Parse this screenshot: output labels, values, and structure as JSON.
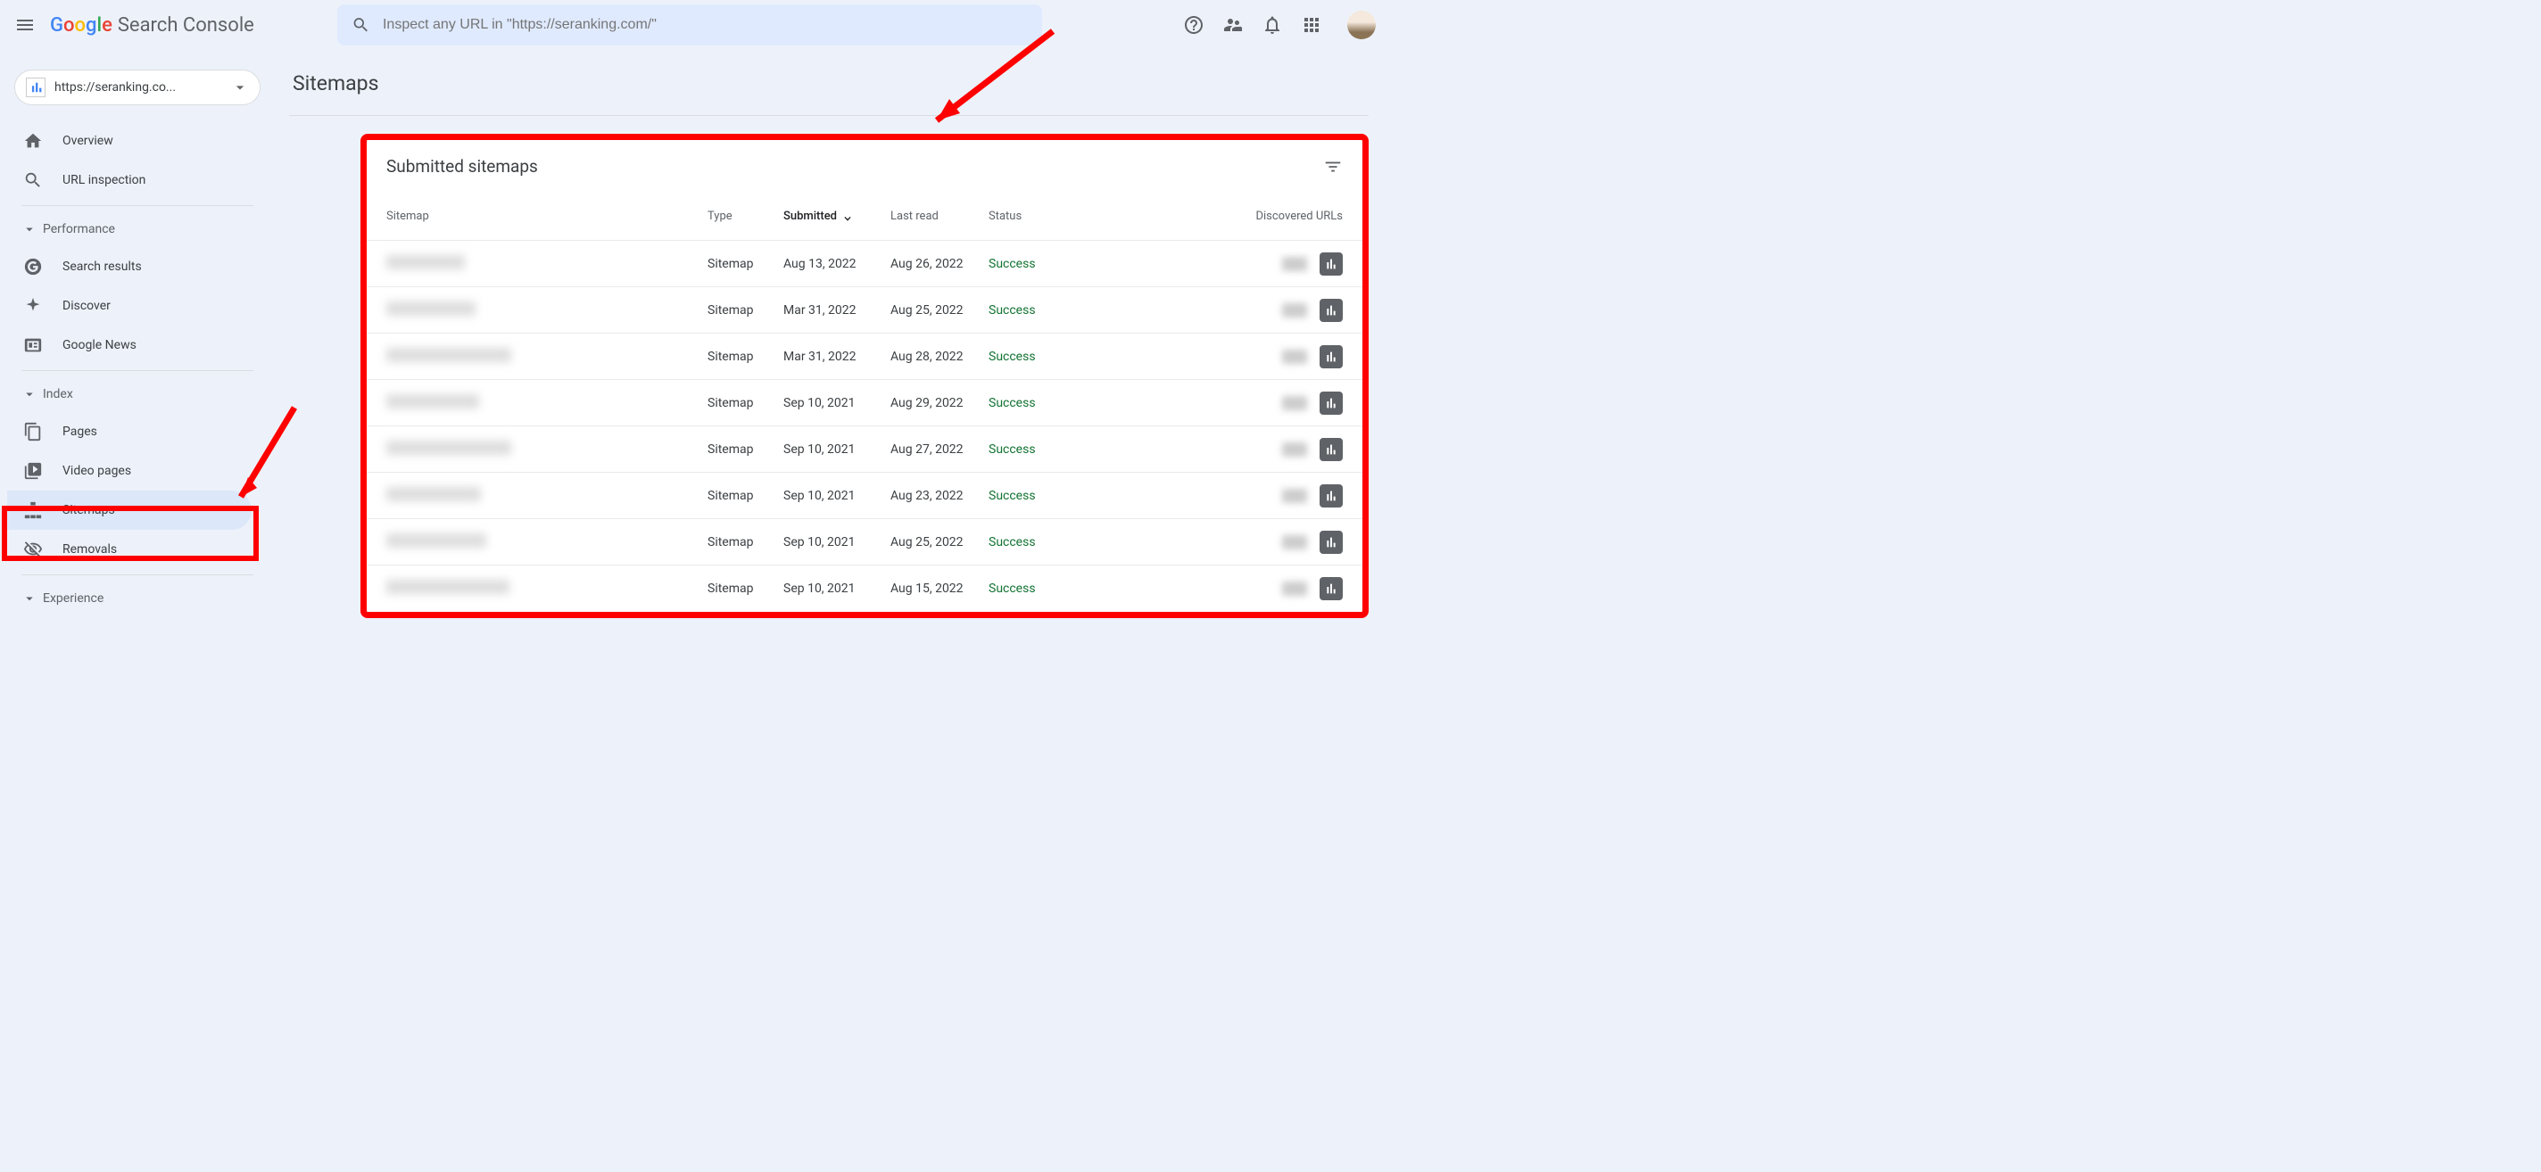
{
  "header": {
    "logo_brand": "Google",
    "logo_product": "Search Console",
    "search_placeholder": "Inspect any URL in \"https://seranking.com/\""
  },
  "property": {
    "url": "https://seranking.co..."
  },
  "sidebar": {
    "overview": "Overview",
    "url_inspection": "URL inspection",
    "section_performance": "Performance",
    "search_results": "Search results",
    "discover": "Discover",
    "google_news": "Google News",
    "section_index": "Index",
    "pages": "Pages",
    "video_pages": "Video pages",
    "sitemaps": "Sitemaps",
    "removals": "Removals",
    "section_experience": "Experience"
  },
  "page": {
    "title": "Sitemaps",
    "card_title": "Submitted sitemaps",
    "columns": {
      "sitemap": "Sitemap",
      "type": "Type",
      "submitted": "Submitted",
      "last_read": "Last read",
      "status": "Status",
      "discovered": "Discovered URLs"
    },
    "rows": [
      {
        "sitemap_w": 88,
        "type": "Sitemap",
        "submitted": "Aug 13, 2022",
        "last_read": "Aug 26, 2022",
        "status": "Success"
      },
      {
        "sitemap_w": 100,
        "type": "Sitemap",
        "submitted": "Mar 31, 2022",
        "last_read": "Aug 25, 2022",
        "status": "Success"
      },
      {
        "sitemap_w": 140,
        "type": "Sitemap",
        "submitted": "Mar 31, 2022",
        "last_read": "Aug 28, 2022",
        "status": "Success"
      },
      {
        "sitemap_w": 104,
        "type": "Sitemap",
        "submitted": "Sep 10, 2021",
        "last_read": "Aug 29, 2022",
        "status": "Success"
      },
      {
        "sitemap_w": 140,
        "type": "Sitemap",
        "submitted": "Sep 10, 2021",
        "last_read": "Aug 27, 2022",
        "status": "Success"
      },
      {
        "sitemap_w": 106,
        "type": "Sitemap",
        "submitted": "Sep 10, 2021",
        "last_read": "Aug 23, 2022",
        "status": "Success"
      },
      {
        "sitemap_w": 112,
        "type": "Sitemap",
        "submitted": "Sep 10, 2021",
        "last_read": "Aug 25, 2022",
        "status": "Success"
      },
      {
        "sitemap_w": 138,
        "type": "Sitemap",
        "submitted": "Sep 10, 2021",
        "last_read": "Aug 15, 2022",
        "status": "Success"
      }
    ]
  }
}
